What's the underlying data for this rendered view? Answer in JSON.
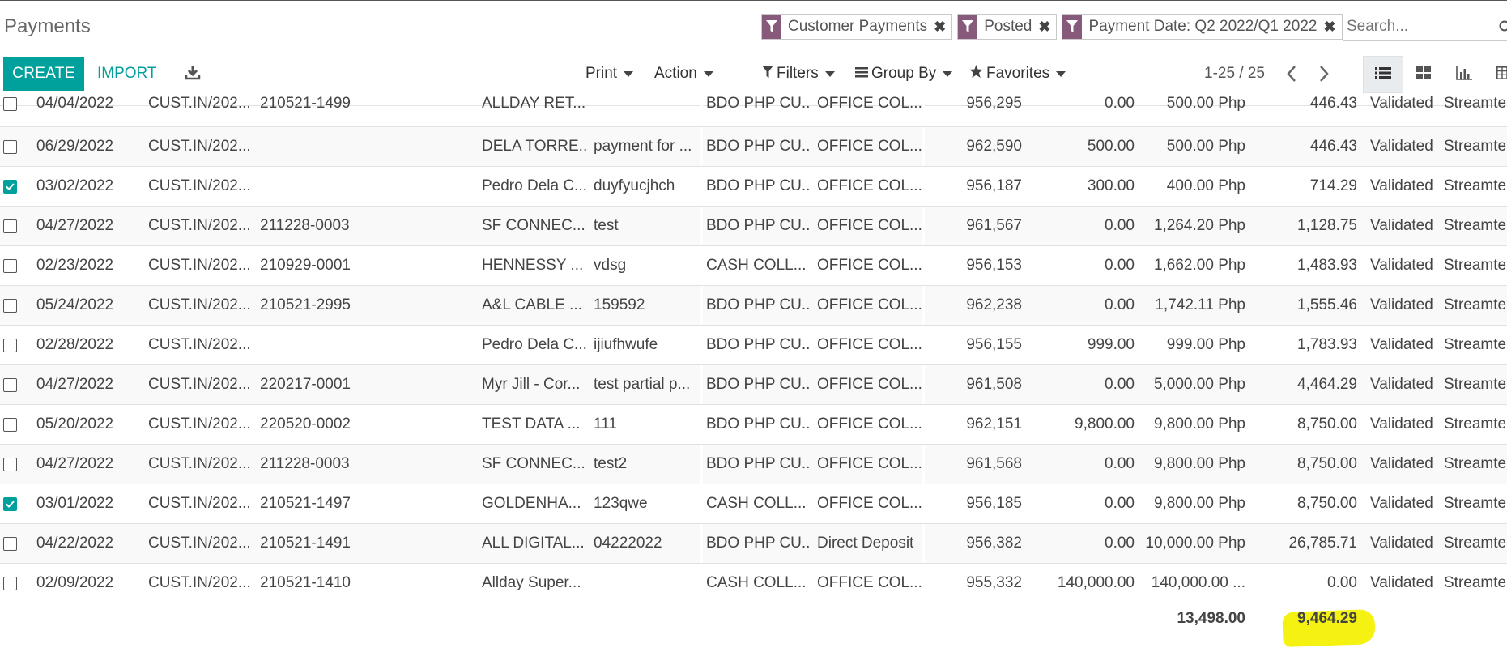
{
  "page": {
    "title": "Payments"
  },
  "search": {
    "facets": [
      {
        "label": "Customer Payments"
      },
      {
        "label": "Posted"
      },
      {
        "label": "Payment Date: Q2 2022/Q1 2022"
      }
    ],
    "placeholder": "Search..."
  },
  "toolbar": {
    "create_label": "CREATE",
    "import_label": "IMPORT",
    "print_label": "Print",
    "action_label": "Action",
    "filters_label": "Filters",
    "groupby_label": "Group By",
    "favorites_label": "Favorites",
    "pager": "1-25 / 25"
  },
  "accent_color": "#00a09d",
  "facet_color": "#875a7b",
  "rows": [
    {
      "checked": false,
      "date": "04/04/2022",
      "number": "CUST.IN/202...",
      "ref": "210521-1499",
      "customer": "ALLDAY RET...",
      "memo": "",
      "journal": "BDO PHP CU...",
      "method": "OFFICE COL...",
      "id": "956,295",
      "amount1": "0.00",
      "amount2": "500.00 Php",
      "amount3": "446.43",
      "status": "Validated",
      "last": "Streamte"
    },
    {
      "checked": false,
      "date": "06/29/2022",
      "number": "CUST.IN/202...",
      "ref": "",
      "customer": "DELA TORRE...",
      "memo": "payment for ...",
      "journal": "BDO PHP CU...",
      "method": "OFFICE COL...",
      "id": "962,590",
      "amount1": "500.00",
      "amount2": "500.00 Php",
      "amount3": "446.43",
      "status": "Validated",
      "last": "Streamte"
    },
    {
      "checked": true,
      "date": "03/02/2022",
      "number": "CUST.IN/202...",
      "ref": "",
      "customer": "Pedro Dela C...",
      "memo": "duyfyucjhch",
      "journal": "BDO PHP CU...",
      "method": "OFFICE COL...",
      "id": "956,187",
      "amount1": "300.00",
      "amount2": "400.00 Php",
      "amount3": "714.29",
      "status": "Validated",
      "last": "Streamte"
    },
    {
      "checked": false,
      "date": "04/27/2022",
      "number": "CUST.IN/202...",
      "ref": "211228-0003",
      "customer": "SF CONNEC...",
      "memo": "test",
      "journal": "BDO PHP CU...",
      "method": "OFFICE COL...",
      "id": "961,567",
      "amount1": "0.00",
      "amount2": "1,264.20 Php",
      "amount3": "1,128.75",
      "status": "Validated",
      "last": "Streamte"
    },
    {
      "checked": false,
      "date": "02/23/2022",
      "number": "CUST.IN/202...",
      "ref": "210929-0001",
      "customer": "HENNESSY ...",
      "memo": "vdsg",
      "journal": "CASH COLL...",
      "method": "OFFICE COL...",
      "id": "956,153",
      "amount1": "0.00",
      "amount2": "1,662.00 Php",
      "amount3": "1,483.93",
      "status": "Validated",
      "last": "Streamte"
    },
    {
      "checked": false,
      "date": "05/24/2022",
      "number": "CUST.IN/202...",
      "ref": "210521-2995",
      "customer": "A&L CABLE ...",
      "memo": "159592",
      "journal": "BDO PHP CU...",
      "method": "OFFICE COL...",
      "id": "962,238",
      "amount1": "0.00",
      "amount2": "1,742.11 Php",
      "amount3": "1,555.46",
      "status": "Validated",
      "last": "Streamte"
    },
    {
      "checked": false,
      "date": "02/28/2022",
      "number": "CUST.IN/202...",
      "ref": "",
      "customer": "Pedro Dela C...",
      "memo": "ijiufhwufe",
      "journal": "BDO PHP CU...",
      "method": "OFFICE COL...",
      "id": "956,155",
      "amount1": "999.00",
      "amount2": "999.00 Php",
      "amount3": "1,783.93",
      "status": "Validated",
      "last": "Streamte"
    },
    {
      "checked": false,
      "date": "04/27/2022",
      "number": "CUST.IN/202...",
      "ref": "220217-0001",
      "customer": "Myr Jill - Cor...",
      "memo": "test partial p...",
      "journal": "BDO PHP CU...",
      "method": "OFFICE COL...",
      "id": "961,508",
      "amount1": "0.00",
      "amount2": "5,000.00 Php",
      "amount3": "4,464.29",
      "status": "Validated",
      "last": "Streamte"
    },
    {
      "checked": false,
      "date": "05/20/2022",
      "number": "CUST.IN/202...",
      "ref": "220520-0002",
      "customer": "TEST DATA ...",
      "memo": "111",
      "journal": "BDO PHP CU...",
      "method": "OFFICE COL...",
      "id": "962,151",
      "amount1": "9,800.00",
      "amount2": "9,800.00 Php",
      "amount3": "8,750.00",
      "status": "Validated",
      "last": "Streamte"
    },
    {
      "checked": false,
      "date": "04/27/2022",
      "number": "CUST.IN/202...",
      "ref": "211228-0003",
      "customer": "SF CONNEC...",
      "memo": "test2",
      "journal": "BDO PHP CU...",
      "method": "OFFICE COL...",
      "id": "961,568",
      "amount1": "0.00",
      "amount2": "9,800.00 Php",
      "amount3": "8,750.00",
      "status": "Validated",
      "last": "Streamte"
    },
    {
      "checked": true,
      "date": "03/01/2022",
      "number": "CUST.IN/202...",
      "ref": "210521-1497",
      "customer": "GOLDENHA...",
      "memo": "123qwe",
      "journal": "CASH COLL...",
      "method": "OFFICE COL...",
      "id": "956,185",
      "amount1": "0.00",
      "amount2": "9,800.00 Php",
      "amount3": "8,750.00",
      "status": "Validated",
      "last": "Streamte"
    },
    {
      "checked": false,
      "date": "04/22/2022",
      "number": "CUST.IN/202...",
      "ref": "210521-1491",
      "customer": "ALL DIGITAL...",
      "memo": "04222022",
      "journal": "BDO PHP CU...",
      "method": "Direct Deposit",
      "id": "956,382",
      "amount1": "0.00",
      "amount2": "10,000.00 Php",
      "amount3": "26,785.71",
      "status": "Validated",
      "last": "Streamte"
    },
    {
      "checked": false,
      "date": "02/09/2022",
      "number": "CUST.IN/202...",
      "ref": "210521-1410",
      "customer": "Allday Super...",
      "memo": "",
      "journal": "CASH COLL...",
      "method": "OFFICE COL...",
      "id": "955,332",
      "amount1": "140,000.00",
      "amount2": "140,000.00 ...",
      "amount3": "0.00",
      "status": "Validated",
      "last": "Streamte"
    }
  ],
  "totals": {
    "amount2": "13,498.00",
    "amount3": "9,464.29",
    "highlight_color": "#f5f212"
  }
}
